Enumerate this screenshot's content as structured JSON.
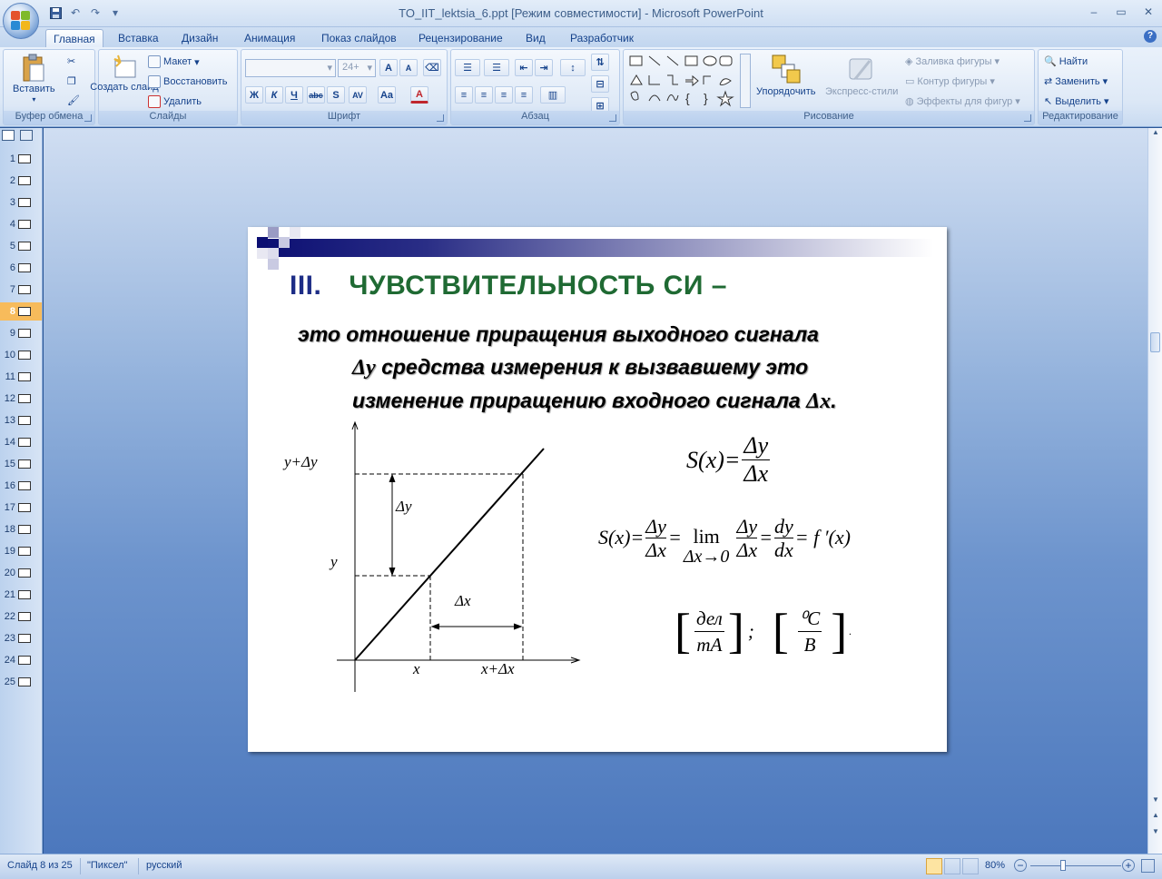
{
  "window": {
    "title": "TO_IIT_lektsia_6.ppt [Режим совместимости] - Microsoft PowerPoint",
    "minimize_icon": "minimize-icon",
    "maximize_icon": "restore-icon",
    "close_icon": "close-icon"
  },
  "quick_access": [
    "save-icon",
    "undo-icon",
    "redo-icon",
    "customize-qat-icon"
  ],
  "tabs": [
    "Главная",
    "Вставка",
    "Дизайн",
    "Анимация",
    "Показ слайдов",
    "Рецензирование",
    "Вид",
    "Разработчик"
  ],
  "active_tab": "Главная",
  "ribbon": {
    "clipboard": {
      "label": "Буфер обмена",
      "paste": "Вставить"
    },
    "slides": {
      "label": "Слайды",
      "new_slide": "Создать слайд",
      "layout": "Макет",
      "reset": "Восстановить",
      "delete": "Удалить"
    },
    "font": {
      "label": "Шрифт",
      "font_name": "",
      "font_size": "24+"
    },
    "paragraph": {
      "label": "Абзац"
    },
    "drawing": {
      "label": "Рисование",
      "arrange": "Упорядочить",
      "quick_styles": "Экспресс-стили",
      "shape_fill": "Заливка фигуры",
      "shape_outline": "Контур фигуры",
      "shape_effects": "Эффекты для фигур"
    },
    "editing": {
      "label": "Редактирование",
      "find": "Найти",
      "replace": "Заменить",
      "select": "Выделить"
    }
  },
  "slide_pane": {
    "current": 8,
    "numbers": [
      "1",
      "2",
      "3",
      "4",
      "5",
      "6",
      "7",
      "8",
      "9",
      "10",
      "11",
      "12",
      "13",
      "14",
      "15",
      "16",
      "17",
      "18",
      "19",
      "20",
      "21",
      "22",
      "23",
      "24",
      "25"
    ]
  },
  "slide": {
    "numeral": "III.",
    "title": "ЧУВСТВИТЕЛЬНОСТЬ СИ  –",
    "line1": "это  отношение  приращения  выходного  сигнала",
    "line2_pre": "Δy",
    "line2": " средства  измерения  к  вызвавшему  это",
    "line3": "изменение приращению входного сигнала ",
    "line3_sym": "Δx",
    "line3_end": ".",
    "graph": {
      "y_plus_dy": "y+Δy",
      "y": "y",
      "dy": "Δy",
      "dx": "Δx",
      "x": "x",
      "x_plus_dx": "x+Δx"
    },
    "formula1_lhs": "S(x)=",
    "formula1_num": "Δy",
    "formula1_den": "Δx",
    "formula2_lhs": "S(x)=",
    "formula2_f1_num": "Δy",
    "formula2_f1_den": "Δx",
    "formula2_eq": "=",
    "formula2_lim": "lim",
    "formula2_lim_sub": "Δx→0",
    "formula2_f2_num": "Δy",
    "formula2_f2_den": "Δx",
    "formula2_f3_num": "dy",
    "formula2_f3_den": "dx",
    "formula2_rhs": "= f ′(x)",
    "unit1_num": "дел",
    "unit1_den": "mA",
    "unit_sep": ";",
    "unit2_num": "⁰C",
    "unit2_den": "B",
    "unit_end": "."
  },
  "status": {
    "slide_info": "Слайд 8 из 25",
    "theme": "\"Пиксел\"",
    "language": "русский",
    "zoom": "80%"
  }
}
